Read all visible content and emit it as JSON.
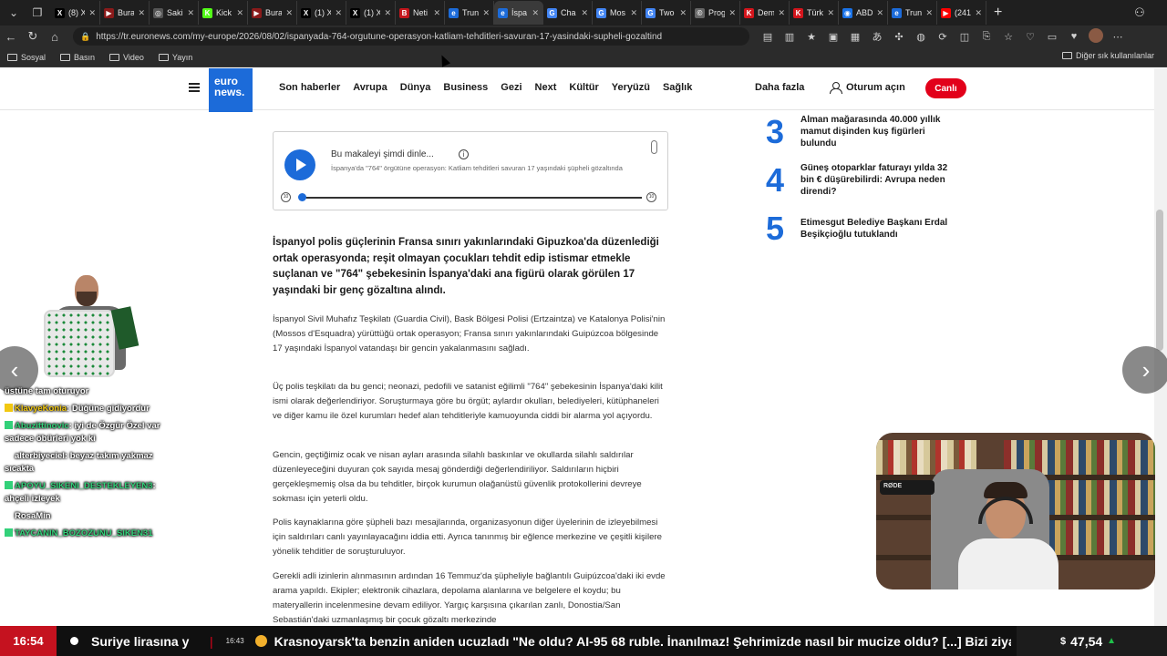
{
  "browser": {
    "tabs": [
      {
        "label": "(8) X",
        "fav_color": "#000000",
        "fav_glyph": "X"
      },
      {
        "label": "Bura",
        "fav_color": "#8a1a1a",
        "fav_glyph": "▶"
      },
      {
        "label": "Saki",
        "fav_color": "#555555",
        "fav_glyph": "◎"
      },
      {
        "label": "Kick",
        "fav_color": "#53fc18",
        "fav_glyph": "K"
      },
      {
        "label": "Bura",
        "fav_color": "#8a1a1a",
        "fav_glyph": "▶"
      },
      {
        "label": "(1) X",
        "fav_color": "#000000",
        "fav_glyph": "X"
      },
      {
        "label": "(1) X",
        "fav_color": "#000000",
        "fav_glyph": "X"
      },
      {
        "label": "Neti",
        "fav_color": "#c4161c",
        "fav_glyph": "B"
      },
      {
        "label": "Trun",
        "fav_color": "#1c6bd9",
        "fav_glyph": "e"
      },
      {
        "label": "İspa",
        "fav_color": "#1c6bd9",
        "fav_glyph": "e",
        "active": true
      },
      {
        "label": "Cha",
        "fav_color": "#4285f4",
        "fav_glyph": "G"
      },
      {
        "label": "Mos",
        "fav_color": "#4285f4",
        "fav_glyph": "G"
      },
      {
        "label": "Two",
        "fav_color": "#4285f4",
        "fav_glyph": "G"
      },
      {
        "label": "Prog",
        "fav_color": "#666666",
        "fav_glyph": "©"
      },
      {
        "label": "Dem",
        "fav_color": "#d4151c",
        "fav_glyph": "K"
      },
      {
        "label": "Türk",
        "fav_color": "#d4151c",
        "fav_glyph": "K"
      },
      {
        "label": "ABD",
        "fav_color": "#1a73e8",
        "fav_glyph": "◉"
      },
      {
        "label": "Trun",
        "fav_color": "#1c6bd9",
        "fav_glyph": "e"
      },
      {
        "label": "(241",
        "fav_color": "#ff0000",
        "fav_glyph": "▶"
      }
    ],
    "url": "https://tr.euronews.com/my-europe/2026/08/02/ispanyada-764-orgutune-operasyon-katliam-tehditleri-savuran-17-yasindaki-supheli-gozaltind",
    "bookmarks": [
      "Sosyal",
      "Basın",
      "Video",
      "Yayın"
    ],
    "bookmarks_right": "Diğer sık kullanılanlar"
  },
  "site": {
    "logo_line1": "euro",
    "logo_line2": "news.",
    "nav": [
      "Son haberler",
      "Avrupa",
      "Dünya",
      "Business",
      "Gezi",
      "Next",
      "Kültür",
      "Yeryüzü",
      "Sağlık"
    ],
    "more": "Daha fazla",
    "login": "Oturum açın",
    "live": "Canlı",
    "accent_color": "#1c6bd9",
    "live_color": "#e2001a"
  },
  "player": {
    "title": "Bu makaleyi şimdi dinle...",
    "subtitle": "İspanya'da \"764\" örgütüne operasyon: Katliam tehditleri savuran 17 yaşındaki şüpheli gözaltında",
    "rewind": "10",
    "forward": "10"
  },
  "article": {
    "lead": "İspanyol polis güçlerinin Fransa sınırı yakınlarındaki Gipuzkoa'da düzenlediği ortak operasyonda; reşit olmayan çocukları tehdit edip istismar etmekle suçlanan ve \"764\" şebekesinin İspanya'daki ana figürü olarak görülen 17 yaşındaki bir genç gözaltına alındı.",
    "paragraphs": [
      "İspanyol Sivil Muhafız Teşkilatı (Guardia Civil), Bask Bölgesi Polisi (Ertzaintza) ve Katalonya Polisi'nin (Mossos d'Esquadra) yürüttüğü ortak operasyon; Fransa sınırı yakınlarındaki Guipúzcoa bölgesinde 17 yaşındaki İspanyol vatandaşı bir gencin yakalanmasını sağladı.",
      "Üç polis teşkilatı da bu genci; neonazi, pedofili ve satanist eğilimli \"764\" şebekesinin İspanya'daki kilit ismi olarak değerlendiriyor. Soruşturmaya göre bu örgüt; aylardır okulları, belediyeleri, kütüphaneleri ve diğer kamu ile özel kurumları hedef alan tehditleriyle kamuoyunda ciddi bir alarma yol açıyordu.",
      "Gencin, geçtiğimiz ocak ve nisan ayları arasında silahlı baskınlar ve okullarda silahlı saldırılar düzenleyeceğini duyuran çok sayıda mesaj gönderdiği değerlendiriliyor. Saldırıların hiçbiri gerçekleşmemiş olsa da bu tehditler, birçok kurumun olağanüstü güvenlik protokollerini devreye sokması için yeterli oldu.",
      "Polis kaynaklarına göre şüpheli bazı mesajlarında, organizasyonun diğer üyelerinin de izleyebilmesi için saldırıları canlı yayınlayacağını iddia etti. Ayrıca tanınmış bir eğlence merkezine ve çeşitli kişilere yönelik tehditler de soruşturuluyor.",
      "Gerekli adli izinlerin alınmasının ardından 16 Temmuz'da şüpheliyle bağlantılı Guipúzcoa'daki iki evde arama yapıldı. Ekipler; elektronik cihazlara, depolama alanlarına ve belgelere el koydu; bu materyallerin incelenmesine devam ediliyor. Yargıç karşısına çıkarılan zanlı, Donostia/San Sebastián'daki uzmanlaşmış bir çocuk gözaltı merkezinde"
    ]
  },
  "most_read": [
    {
      "rank": "3",
      "title": "Alman mağarasında 40.000 yıllık mamut dişinden kuş figürleri bulundu"
    },
    {
      "rank": "4",
      "title": "Güneş otoparklar faturayı yılda 32 bin € düşürebilirdi: Avrupa neden direndi?"
    },
    {
      "rank": "5",
      "title": "Etimesgut Belediye Başkanı Erdal Beşikçioğlu tutuklandı"
    }
  ],
  "stream_chat": [
    {
      "user": "",
      "text": "üstüne tam oturuyor",
      "color": "#ffffff"
    },
    {
      "user": "KlavyeKonia",
      "text": "Düğüne gidiyordur",
      "color": "#f2c811"
    },
    {
      "user": "Abuzittinovic",
      "text": "iyi de Özgür Özel var sadece öbürleri yok ki",
      "color": "#33d17a"
    },
    {
      "user": "alterbiyeciel",
      "text": "beyaz takım yakmaz sıcakta",
      "color": "#ffffff"
    },
    {
      "user": "APOYU_SIKENI_DESTEKLEYEN3",
      "text": "ahçeli izleyek",
      "color": "#33d17a"
    },
    {
      "user": "RosaMin",
      "text": "",
      "color": "#ffffff"
    },
    {
      "user": "TAYCANIN_BOZOZUNU_SIKEN31",
      "text": "",
      "color": "#33d17a"
    }
  ],
  "webcam": {
    "mic_brand": "RØDE"
  },
  "ticker": {
    "clock": "16:54",
    "item1": "Suriye lirasına y",
    "time2": "16:43",
    "item2": "Krasnoyarsk'ta benzin aniden ucuzladı \"Ne oldu? AI-95 68 ruble. İnanılmaz! Şehrimizde nasıl bir mucize oldu? [...] Bizi ziyaret",
    "fx_currency": "$",
    "fx_value": "47,54",
    "fx_trend": "▲"
  }
}
